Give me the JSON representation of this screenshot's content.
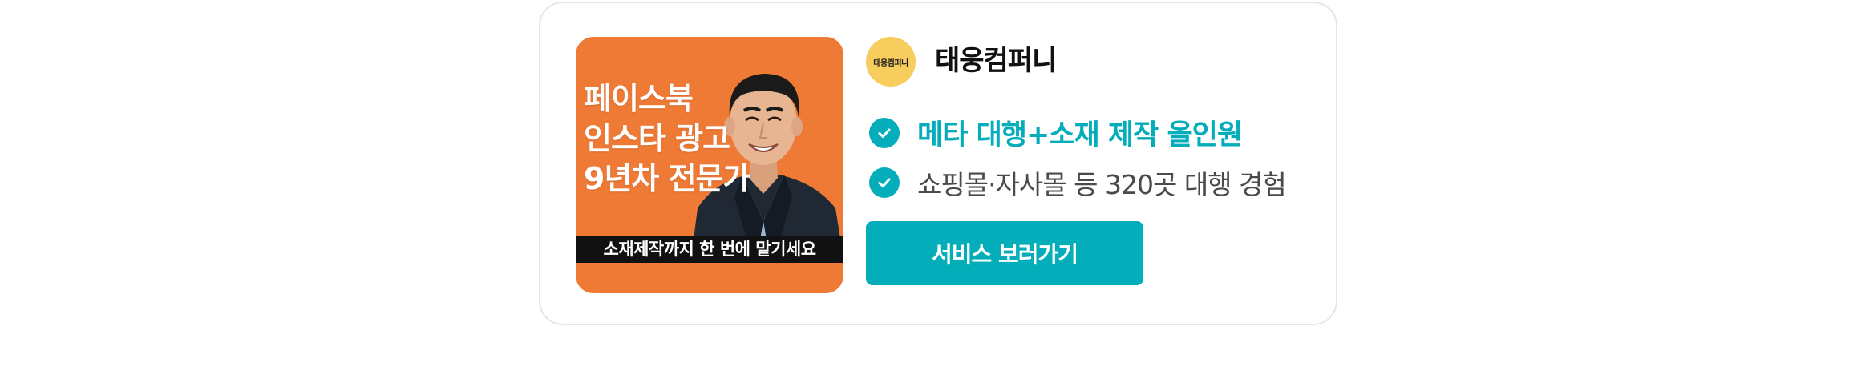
{
  "ad": {
    "thumbnail": {
      "headline_lines": [
        "페이스북",
        "인스타 광고",
        "9년차 전문가"
      ],
      "banner": "소재제작까지  한 번에 맡기세요"
    },
    "logo_text": "태웅컴퍼니",
    "company_name": "태웅컴퍼니",
    "features": [
      {
        "icon": "check-circle-icon",
        "text": "메타 대행+소재 제작 올인원"
      },
      {
        "icon": "check-circle-icon",
        "text": "쇼핑몰·자사몰 등 320곳 대행 경험"
      }
    ],
    "cta_label": "서비스 보러가기"
  },
  "colors": {
    "accent": "#04adba",
    "thumbnail_bg": "#ef7a36",
    "logo_bg": "#f7cd5e",
    "border": "#e6e6e6"
  }
}
